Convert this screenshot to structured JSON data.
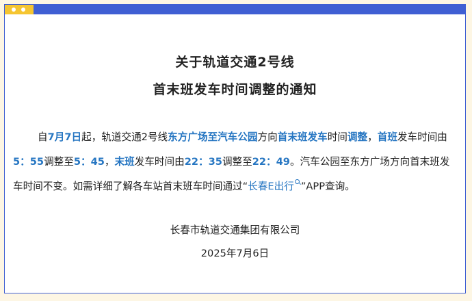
{
  "colors": {
    "accent_blue": "#3f5fd3",
    "accent_yellow": "#f5c531",
    "highlight_text": "#2676c2",
    "page_background": "#fdf6e4"
  },
  "notice": {
    "title_line1": "关于轨道交通2号线",
    "title_line2": "首末班发车时间调整的通知",
    "body": {
      "t1": "自",
      "h1": "7月7日",
      "t2": "起，轨道交通2号线",
      "h2": "东方广场至汽车公园",
      "t3": "方向",
      "h3": "首末班发车",
      "t4": "时间",
      "h4": "调整",
      "t5": "，",
      "h5": "首班",
      "t6": "发车时间由",
      "h6": "5：55",
      "t7": "调整至",
      "h7": "5：45",
      "t8": "，",
      "h8": "末班",
      "t9": "发车时间由",
      "h9": "22：35",
      "t10": "调整至",
      "h10": "22：49",
      "t11": "。汽车公园至东方广场方向首末班发车时间不变。如需详细了解各车站首末班车时间通过“",
      "app_name": "长春E出行",
      "search_icon": "search-icon",
      "t12": "”APP查询。"
    },
    "organization": "长春市轨道交通集团有限公司",
    "date": "2025年7月6日"
  }
}
